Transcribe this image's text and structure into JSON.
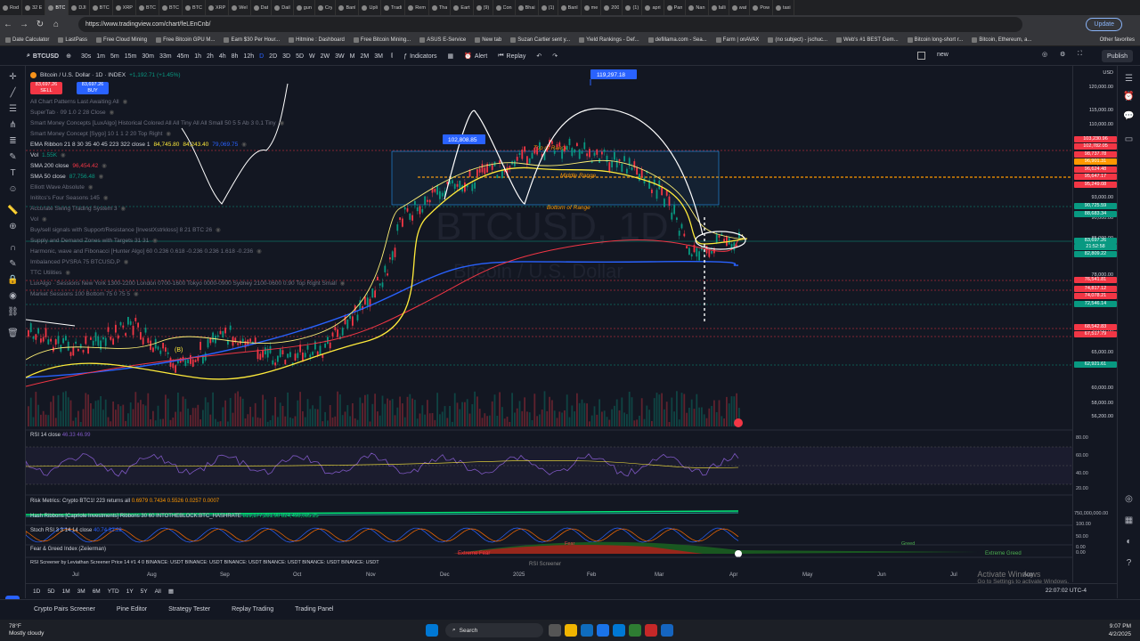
{
  "browser": {
    "tabs": [
      "Rod",
      "32 E",
      "BTC",
      "DJI",
      "BTC",
      "XRP",
      "BTC",
      "BTC",
      "BTC",
      "XRP",
      "Wel",
      "Dat",
      "Dail",
      "gun",
      "Cry",
      "Banl",
      "Upli",
      "Tradi",
      "Rem",
      "Tha",
      "Eart",
      "(9)",
      "Con",
      "Bhai",
      "(1)",
      "Banl",
      "me",
      "200",
      "(1)",
      "apri",
      "Pan",
      "Nan",
      "falli",
      "wat",
      "Pow",
      "taxi"
    ],
    "url": "https://www.tradingview.com/chart/feLEnCnb/",
    "update_label": "Update",
    "bookmarks": [
      "Date Calculator",
      "LastPass",
      "Free Cloud Mining",
      "Free Bitcoin GPU M...",
      "Earn $30 Per Hour...",
      "Hitmine : Dashboard",
      "Free Bitcoin Mining...",
      "ASUS E-Service",
      "New tab",
      "Suzan Cartier sent y...",
      "Yield Rankings - Def...",
      "defillama.com - Sea...",
      "Farm | onAVAX",
      "(no subject) - jschuc...",
      "Web's #1 BEST Gem...",
      "Bitcoin long-short r...",
      "Bitcoin, Ethereum, a..."
    ],
    "other_favorites": "Other favorites"
  },
  "toolbar": {
    "symbol": "BTCUSD",
    "timeframes": [
      "30s",
      "1m",
      "5m",
      "15m",
      "30m",
      "33m",
      "45m",
      "1h",
      "2h",
      "4h",
      "8h",
      "12h",
      "D",
      "2D",
      "3D",
      "5D",
      "W",
      "2W",
      "3W",
      "M",
      "2M",
      "3M"
    ],
    "indicators_label": "Indicators",
    "alert_label": "Alert",
    "replay_label": "Replay",
    "layout_name": "new",
    "publish_label": "Publish"
  },
  "legend": {
    "title": "Bitcoin / U.S. Dollar · 1D · INDEX",
    "change": "+1,192.71 (+1.45%)",
    "sell_price": "83,697.26",
    "sell_label": "SELL",
    "buy_price": "83,697.26",
    "buy_label": "BUY",
    "rows": [
      "All Chart Patterns Last Awaiting All",
      "SuperTab · 09 1.0 2 28 Close",
      "Smart Money Concepts [LuxAlgo] Historical Colored All All Tiny All All Small 50 5 5 Ab 3 0.1 Tiny",
      "Smart Money Concept [Sygo] 10 1 1 2 20 Top Right",
      "EMA Ribbon 21 8 30 35 40 45 223 322 close 1",
      "Vol",
      "SMA 200 close",
      "SMA 50 close",
      "Elliott Wave Absolute",
      "Inititcs's Four Seasons 145",
      "Accurate Swing Trading System 3",
      "Vol",
      "Buy/sell signals with Support/Resistance [InvestXstrkloss] 8 21 BTC 26",
      "Supply and Demand Zones with Targets 31 31",
      "Harmonic, wave and Fibonacci [Hunter Algo] 60 0.236 0.618 -0.236 0.236 1.618 -0.236",
      "Imbalanced PVSRA 75 BTCUSD,P",
      "TTC Utilities",
      "LuxAlgo · Sessions New York 1300-2200 London 0700-1600 Tokyo 0000-0900 Sydney 2100-0600 0.90 Top Right Small",
      "Market Sessions 100 Bottom 75 0 75 5"
    ],
    "ema_values": [
      "84,745.80",
      "84,243.40",
      "79,069.75"
    ],
    "vol_value": "1.55K",
    "sma200_value": "96,454.42",
    "sma50_value": "87,756.48"
  },
  "chart": {
    "watermark": "BTCUSD, 1D",
    "watermark_sub": "Bitcoin / U.S. Dollar",
    "callout_high": "119,297.18",
    "callout_peak": "102,808.85",
    "zone_top": "Top of Range",
    "zone_mid": "Middle Range",
    "zone_bottom": "Bottom of Range",
    "wave_label": "(B)"
  },
  "price_scale": {
    "labels": [
      "120,000.00",
      "115,000.00",
      "110,000.00",
      "105,000.00",
      "100,000.00",
      "95,000.00",
      "93,000.00",
      "90,000.00",
      "85,000.00",
      "78,000.00",
      "70,000.00",
      "65,000.00",
      "62,000.00",
      "60,000.00",
      "58,000.00",
      "56,200.00"
    ],
    "boxes": [
      {
        "v": "103,230.96",
        "c": "#f23645"
      },
      {
        "v": "102,782.05",
        "c": "#f23645"
      },
      {
        "v": "98,737.78",
        "c": "#f23645"
      },
      {
        "v": "96,901.31",
        "c": "#ff9800"
      },
      {
        "v": "96,624.48",
        "c": "#f23645"
      },
      {
        "v": "95,647.17",
        "c": "#f23645"
      },
      {
        "v": "95,249.08",
        "c": "#f23645"
      },
      {
        "v": "90,725.59",
        "c": "#089981"
      },
      {
        "v": "88,683.34",
        "c": "#089981"
      },
      {
        "v": "83,697.26",
        "c": "#089981"
      },
      {
        "v": "21:52:58",
        "c": "#089981"
      },
      {
        "v": "82,809.22",
        "c": "#089981"
      },
      {
        "v": "76,541.81",
        "c": "#f23645"
      },
      {
        "v": "74,817.12",
        "c": "#f23645"
      },
      {
        "v": "74,078.21",
        "c": "#f23645"
      },
      {
        "v": "72,546.14",
        "c": "#089981"
      },
      {
        "v": "68,542.83",
        "c": "#f23645"
      },
      {
        "v": "67,517.79",
        "c": "#f23645"
      },
      {
        "v": "62,921.61",
        "c": "#089981"
      }
    ],
    "usd_label": "USD"
  },
  "panes": {
    "rsi_label": "RSI 14 close",
    "rsi_values": "46.33  46.99",
    "rsi_scale": [
      "80.00",
      "60.00",
      "40.00",
      "20.00"
    ],
    "risk_label": "Risk Metrics: Crypto BTC1! 223 returns all",
    "risk_values": "0.6979  0.7434  0.5526  0.0257  0.0007",
    "hash_label": "Hash Ribbons [Capriole Investments] Ribbons 30 60 INTOTHEBLOCK:BTC_HASHRATE",
    "hash_values": "819,177,281.90  824,498,085.25",
    "hash_scale": "750,000,000.00",
    "stoch_label": "Stoch RSI 3 3 14 14 close",
    "stoch_values": "40.74  32.28",
    "stoch_scale": [
      "100.00",
      "50.00",
      "0.00"
    ],
    "fg_label": "Fear & Greed Index (Zeiierman)",
    "fg_extreme_fear": "Extreme Fear",
    "fg_fear": "Fear",
    "fg_greed": "Greed",
    "fg_extreme_greed": "Extreme Greed",
    "fg_scale": "0.00",
    "screener_label": "RSI Screener by Leviathan Screener Price 14 #1 4 0 BINANCE: USDT BINANCE: USDT BINANCE: USDT BINANCE: USDT BINANCE: USDT BINANCE: USDT",
    "screener_title": "RSI Screener"
  },
  "time_axis": {
    "labels": [
      "Jul",
      "Aug",
      "Sep",
      "Oct",
      "Nov",
      "Dec",
      "2025",
      "Feb",
      "Mar",
      "Apr",
      "May",
      "Jun",
      "Jul",
      "Aug"
    ],
    "ranges": [
      "1D",
      "5D",
      "1M",
      "3M",
      "6M",
      "YTD",
      "1Y",
      "5Y",
      "All"
    ],
    "clock": "22:07:02 UTC-4"
  },
  "bottom_panel": {
    "tabs": [
      "Crypto Pairs Screener",
      "Pine Editor",
      "Strategy Tester",
      "Replay Trading",
      "Trading Panel"
    ]
  },
  "activate_windows": {
    "title": "Activate Windows",
    "sub": "Go to Settings to activate Windows."
  },
  "taskbar": {
    "temp": "78°F",
    "weather": "Mostly cloudy",
    "search": "Search",
    "time": "9:07 PM",
    "date": "4/2/2025"
  }
}
